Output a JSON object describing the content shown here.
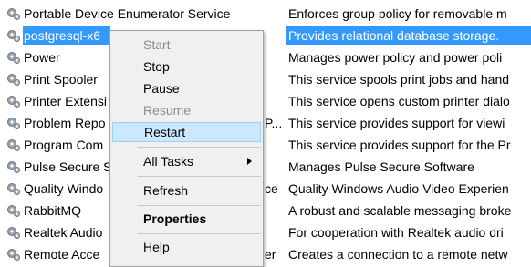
{
  "services": [
    {
      "name": "Portable Device Enumerator Service",
      "description": "Enforces group policy for removable m",
      "selected": false
    },
    {
      "name": "postgresql-x6",
      "description": "Provides relational database storage.",
      "selected": true
    },
    {
      "name": "Power",
      "description": "Manages power policy and power poli",
      "selected": false
    },
    {
      "name": "Print Spooler",
      "description": "This service spools print jobs and hand",
      "selected": false
    },
    {
      "name": "Printer Extensi",
      "description": "This service opens custom printer dialo",
      "selected": false
    },
    {
      "name": "Problem Repo",
      "name_tail": "P...",
      "description": "This service provides support for viewi",
      "selected": false
    },
    {
      "name": "Program Com",
      "description": "This service provides support for the Pr",
      "selected": false
    },
    {
      "name": "Pulse Secure S",
      "description": "Manages Pulse Secure Software",
      "selected": false
    },
    {
      "name": "Quality Windo",
      "name_tail": "ce",
      "description": "Quality Windows Audio Video Experien",
      "selected": false
    },
    {
      "name": "RabbitMQ",
      "description": "A robust and scalable messaging broke",
      "selected": false
    },
    {
      "name": "Realtek Audio",
      "description": "For cooperation with Realtek audio dri",
      "selected": false
    },
    {
      "name": "Remote Acce",
      "name_tail": "er",
      "description": "Creates a connection to a remote netw",
      "selected": false
    }
  ],
  "context_menu": {
    "start": "Start",
    "stop": "Stop",
    "pause": "Pause",
    "resume": "Resume",
    "restart": "Restart",
    "all_tasks": "All Tasks",
    "refresh": "Refresh",
    "properties": "Properties",
    "help": "Help"
  },
  "icon": "service-gear-icon",
  "colors": {
    "selection": "#3399ff",
    "menu_hover": "#cce8ff"
  }
}
